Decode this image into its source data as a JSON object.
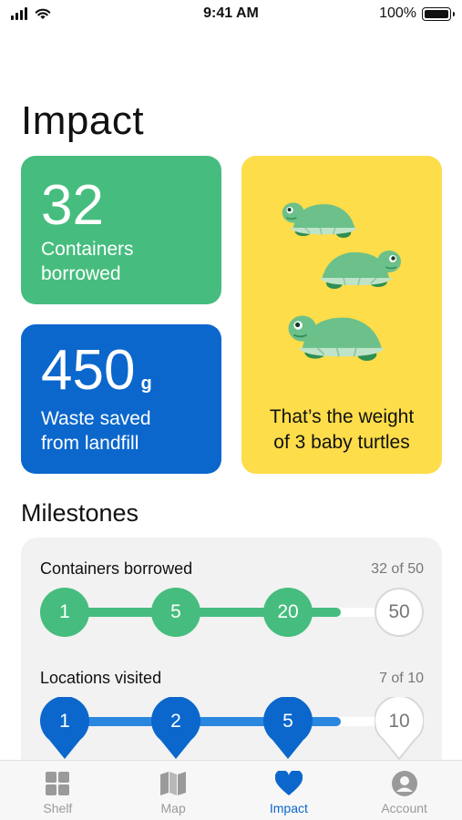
{
  "status_bar": {
    "time": "9:41 AM",
    "battery": "100%"
  },
  "page_title": "Impact",
  "stats": {
    "containers": {
      "value": "32",
      "label": "Containers\nborrowed",
      "color": "#46bd7e"
    },
    "waste": {
      "value": "450",
      "unit": "g",
      "label": "Waste saved\nfrom landfill",
      "color": "#0b67cc"
    },
    "comparison": {
      "label": "That’s the weight\nof 3 baby turtles",
      "icon": "turtle-illustration",
      "color": "#fddd4a"
    }
  },
  "milestones": {
    "title": "Milestones",
    "rows": [
      {
        "label": "Containers borrowed",
        "count": "32 of 50",
        "progress": 0.64,
        "color": "#46bd7e",
        "shape": "circle",
        "steps": [
          "1",
          "5",
          "20",
          "50"
        ],
        "achieved": [
          true,
          true,
          true,
          false
        ]
      },
      {
        "label": "Locations visited",
        "count": "7 of 10",
        "progress": 0.7,
        "color": "#0b67cc",
        "shape": "pin",
        "steps": [
          "1",
          "2",
          "5",
          "10"
        ],
        "achieved": [
          true,
          true,
          true,
          false
        ]
      }
    ]
  },
  "tabs": [
    {
      "label": "Shelf",
      "icon": "grid-icon",
      "active": false
    },
    {
      "label": "Map",
      "icon": "map-icon",
      "active": false
    },
    {
      "label": "Impact",
      "icon": "heart-icon",
      "active": true
    },
    {
      "label": "Account",
      "icon": "account-icon",
      "active": false
    }
  ]
}
